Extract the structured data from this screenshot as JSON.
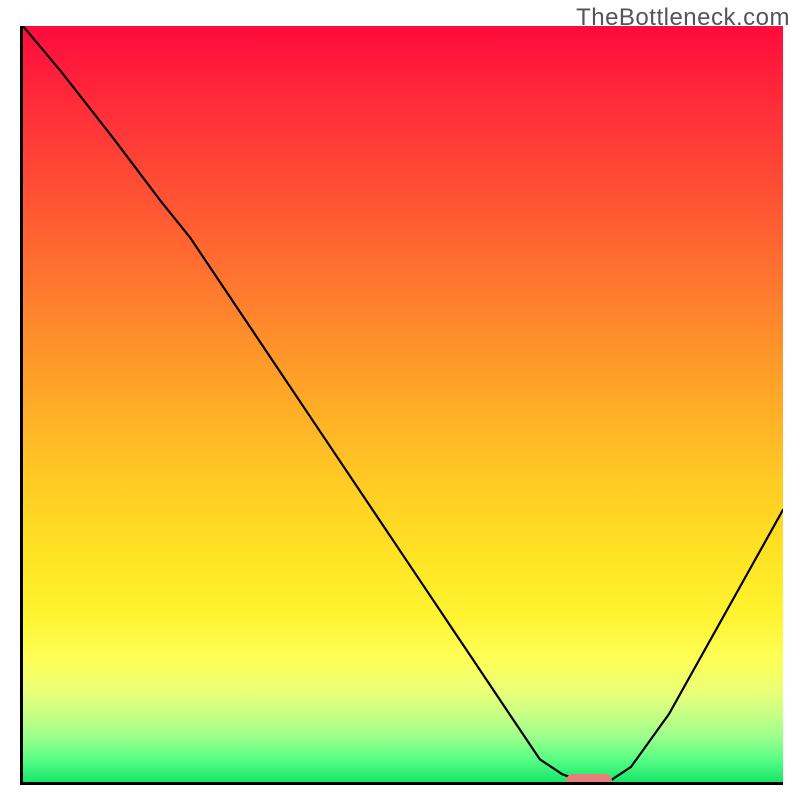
{
  "watermark": "TheBottleneck.com",
  "colors": {
    "axis": "#000000",
    "curve": "#000000",
    "nub": "#e87f7a",
    "gradient_top": "#ff0a3c",
    "gradient_bottom": "#17e66a"
  },
  "chart_data": {
    "type": "line",
    "title": "",
    "xlabel": "",
    "ylabel": "",
    "xlim": [
      0,
      100
    ],
    "ylim": [
      0,
      100
    ],
    "grid": false,
    "legend": false,
    "series": [
      {
        "name": "bottleneck-curve",
        "x": [
          0,
          5,
          12,
          18,
          22,
          30,
          40,
          50,
          58,
          64,
          68,
          71,
          74,
          77,
          80,
          85,
          90,
          95,
          100
        ],
        "y": [
          100,
          94,
          85,
          77,
          72,
          60,
          45,
          30,
          18,
          9,
          3,
          1,
          0,
          0,
          2,
          9,
          18,
          27,
          36
        ]
      }
    ],
    "marker": {
      "name": "optimal-range",
      "x_start": 71.5,
      "x_end": 77.5,
      "y": 0
    },
    "background_gradient": {
      "orientation": "vertical",
      "stops": [
        {
          "pos": 0.0,
          "color": "#ff0a3c"
        },
        {
          "pos": 0.35,
          "color": "#ff7a2e"
        },
        {
          "pos": 0.6,
          "color": "#ffca24"
        },
        {
          "pos": 0.84,
          "color": "#fdff59"
        },
        {
          "pos": 1.0,
          "color": "#17e66a"
        }
      ]
    }
  }
}
